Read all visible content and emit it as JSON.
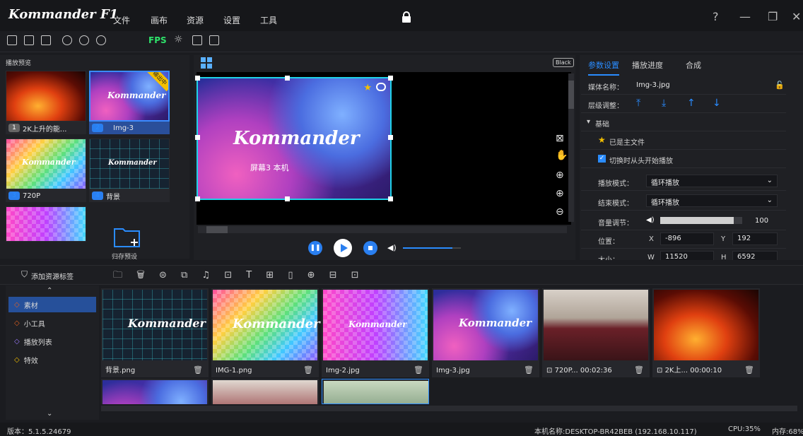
{
  "app": {
    "logo": "Kommander F1"
  },
  "menu": [
    "文件",
    "画布",
    "资源",
    "设置",
    "工具"
  ],
  "toolbar": {
    "fps_label": "FPS"
  },
  "playlist": {
    "title": "播放预览",
    "items": [
      {
        "num": "1",
        "label": "2K上升的能..."
      },
      {
        "num": "2",
        "label": "Img-3",
        "badge": "输出中"
      },
      {
        "num": "3",
        "label": "720P"
      },
      {
        "num": "4",
        "label": "背景"
      },
      {
        "num": "",
        "label": ""
      }
    ],
    "new_group_label": "归存预设"
  },
  "preview": {
    "black_badge": "Black",
    "stage_text": "屏幕3 本机",
    "stage_logo": "Kommander",
    "volume_pct": 0.85
  },
  "right_panel": {
    "tabs": [
      "参数设置",
      "播放进度",
      "合成"
    ],
    "media_name_label": "媒体名称：",
    "media_name_value": "Img-3.jpg",
    "layer_label": "层级调整：",
    "section_basic": "基础",
    "main_file_label": "已是主文件",
    "restart_label": "切换时从头开始播放",
    "play_mode_label": "播放模式：",
    "play_mode_value": "循环播放",
    "end_mode_label": "结束模式：",
    "end_mode_value": "循环播放",
    "volume_label": "音量调节：",
    "volume_value": "100",
    "volume_pct": 0.9,
    "position_label": "位置：",
    "x_label": "X",
    "x_value": "-896",
    "y_label": "Y",
    "y_value": "192",
    "size_label": "大小：",
    "w_label": "W",
    "w_value": "11520",
    "h_label": "H",
    "h_value": "6592"
  },
  "bottom": {
    "add_tag_label": "添加资源标签",
    "categories": [
      "素材",
      "小工具",
      "播放列表",
      "特效"
    ],
    "assets": [
      {
        "label": "背景.png"
      },
      {
        "label": "IMG-1.png"
      },
      {
        "label": "Img-2.jpg"
      },
      {
        "label": "Img-3.jpg"
      },
      {
        "label": "720P...",
        "duration": "00:02:36"
      },
      {
        "label": "2K上...",
        "duration": "00:00:10"
      }
    ]
  },
  "status": {
    "version": "版本：5.1.5.24679",
    "host": "本机名称:DESKTOP-BR42BEB (192.168.10.117)",
    "cpu": "CPU:35%",
    "mem": "内存:68%"
  }
}
